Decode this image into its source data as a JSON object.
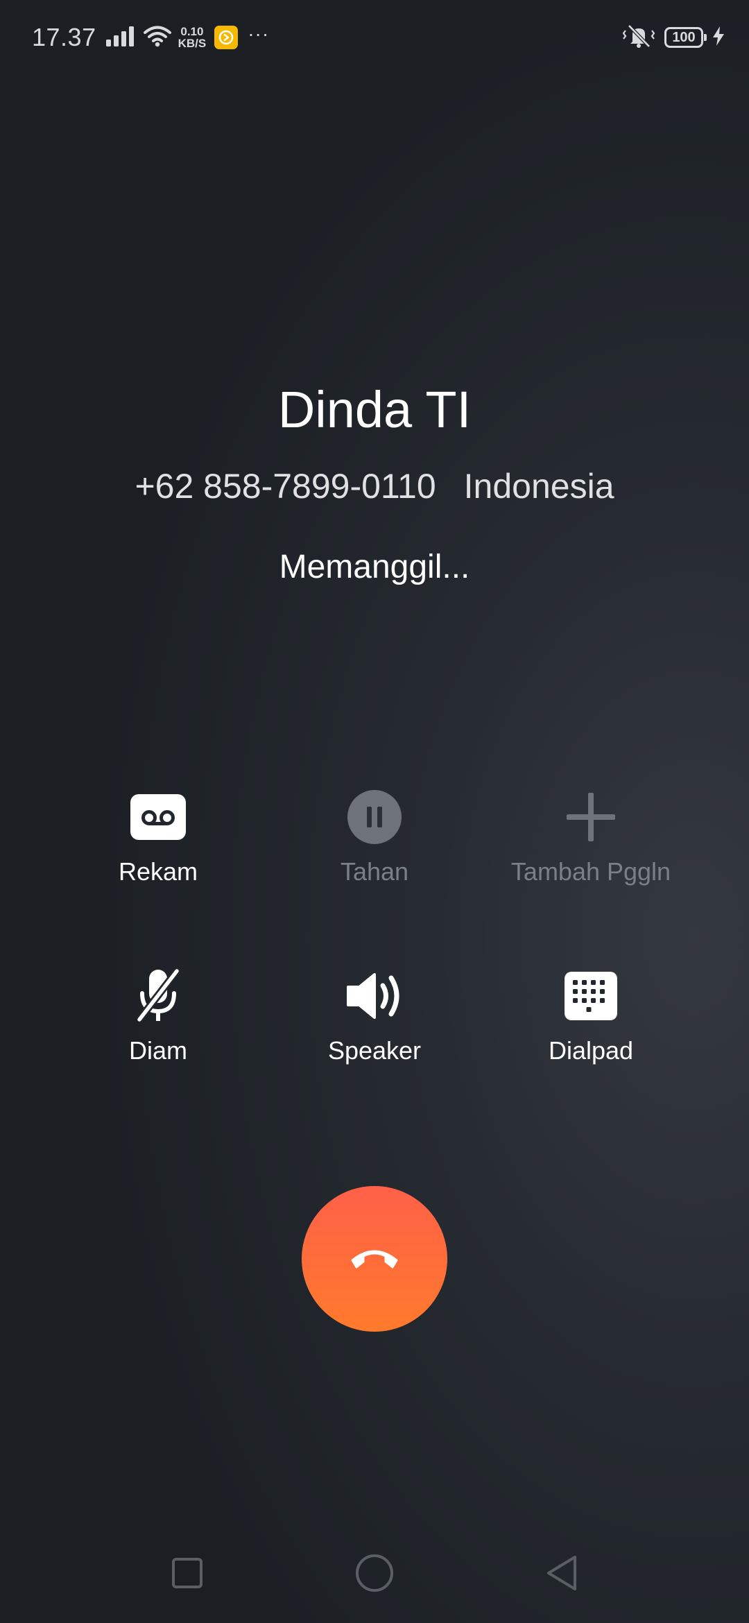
{
  "status_bar": {
    "time": "17.37",
    "net_speed_value": "0.10",
    "net_speed_unit": "KB/S",
    "more_indicator": "···",
    "battery_level": "100",
    "icons": [
      "signal-icon",
      "wifi-icon",
      "app-notification-icon",
      "vibrate-icon",
      "battery-icon",
      "charging-icon"
    ]
  },
  "contact": {
    "name": "Dinda TI",
    "phone": "+62 858-7899-0110",
    "location": "Indonesia"
  },
  "call_status": "Memanggil...",
  "actions": [
    {
      "id": "record",
      "label": "Rekam",
      "icon": "voicemail-icon",
      "enabled": true
    },
    {
      "id": "hold",
      "label": "Tahan",
      "icon": "pause-icon",
      "enabled": false
    },
    {
      "id": "add_call",
      "label": "Tambah Pggln",
      "icon": "plus-icon",
      "enabled": false
    },
    {
      "id": "mute",
      "label": "Diam",
      "icon": "mic-off-icon",
      "enabled": true
    },
    {
      "id": "speaker",
      "label": "Speaker",
      "icon": "speaker-icon",
      "enabled": true
    },
    {
      "id": "dialpad",
      "label": "Dialpad",
      "icon": "dialpad-icon",
      "enabled": true
    }
  ],
  "end_call": {
    "icon": "hang-up-icon",
    "color": "#ff6a3a"
  },
  "nav_bar": {
    "icons": [
      "recent-apps-icon",
      "home-icon",
      "back-icon"
    ]
  },
  "colors": {
    "background": "#22272d",
    "disabled_text": "#7b8087",
    "end_call_top": "#ff6048",
    "end_call_bottom": "#ff7a2c"
  }
}
